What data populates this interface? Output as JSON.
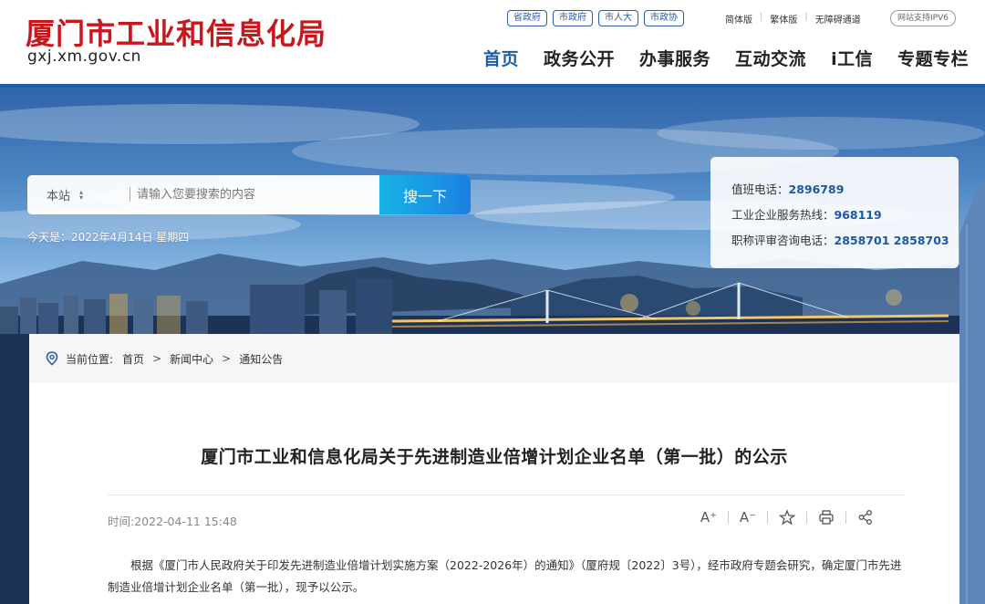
{
  "site": {
    "title": "厦门市工业和信息化局",
    "domain": "gxj.xm.gov.cn"
  },
  "top_links": [
    "省政府",
    "市政府",
    "市人大",
    "市政协"
  ],
  "util_links": [
    "简体版",
    "繁体版",
    "无障碍通道"
  ],
  "ipv6_badge": "网站支持IPV6",
  "nav": [
    {
      "label": "首页",
      "active": true
    },
    {
      "label": "政务公开",
      "active": false
    },
    {
      "label": "办事服务",
      "active": false
    },
    {
      "label": "互动交流",
      "active": false
    },
    {
      "label": "i工信",
      "active": false
    },
    {
      "label": "专题专栏",
      "active": false
    }
  ],
  "search": {
    "scope": "本站",
    "placeholder": "请输入您要搜索的内容",
    "button": "搜一下"
  },
  "today": "今天是：2022年4月14日 星期四",
  "hotline": {
    "duty_label": "值班电话：",
    "duty_number": "2896789",
    "enterprise_label": "工业企业服务热线：",
    "enterprise_number": "968119",
    "title_label": "职称评审咨询电话：",
    "title_number": "2858701 2858703"
  },
  "breadcrumb": {
    "label": "当前位置:",
    "items": [
      "首页",
      "新闻中心",
      "通知公告"
    ]
  },
  "article": {
    "title": "厦门市工业和信息化局关于先进制造业倍增计划企业名单（第一批）的公示",
    "time": "时间:2022-04-11 15:48",
    "body": "根据《厦门市人民政府关于印发先进制造业倍增计划实施方案（2022-2026年）的通知》（厦府规〔2022〕3号），经市政府专题会研究，确定厦门市先进制造业倍增计划企业名单（第一批），现予以公示。"
  },
  "tools": {
    "font_larger": "A⁺",
    "font_smaller": "A⁻"
  },
  "colors": {
    "brand_red": "#c8161d",
    "brand_blue": "#1b5ea6",
    "search_button": "#17b4e6"
  }
}
